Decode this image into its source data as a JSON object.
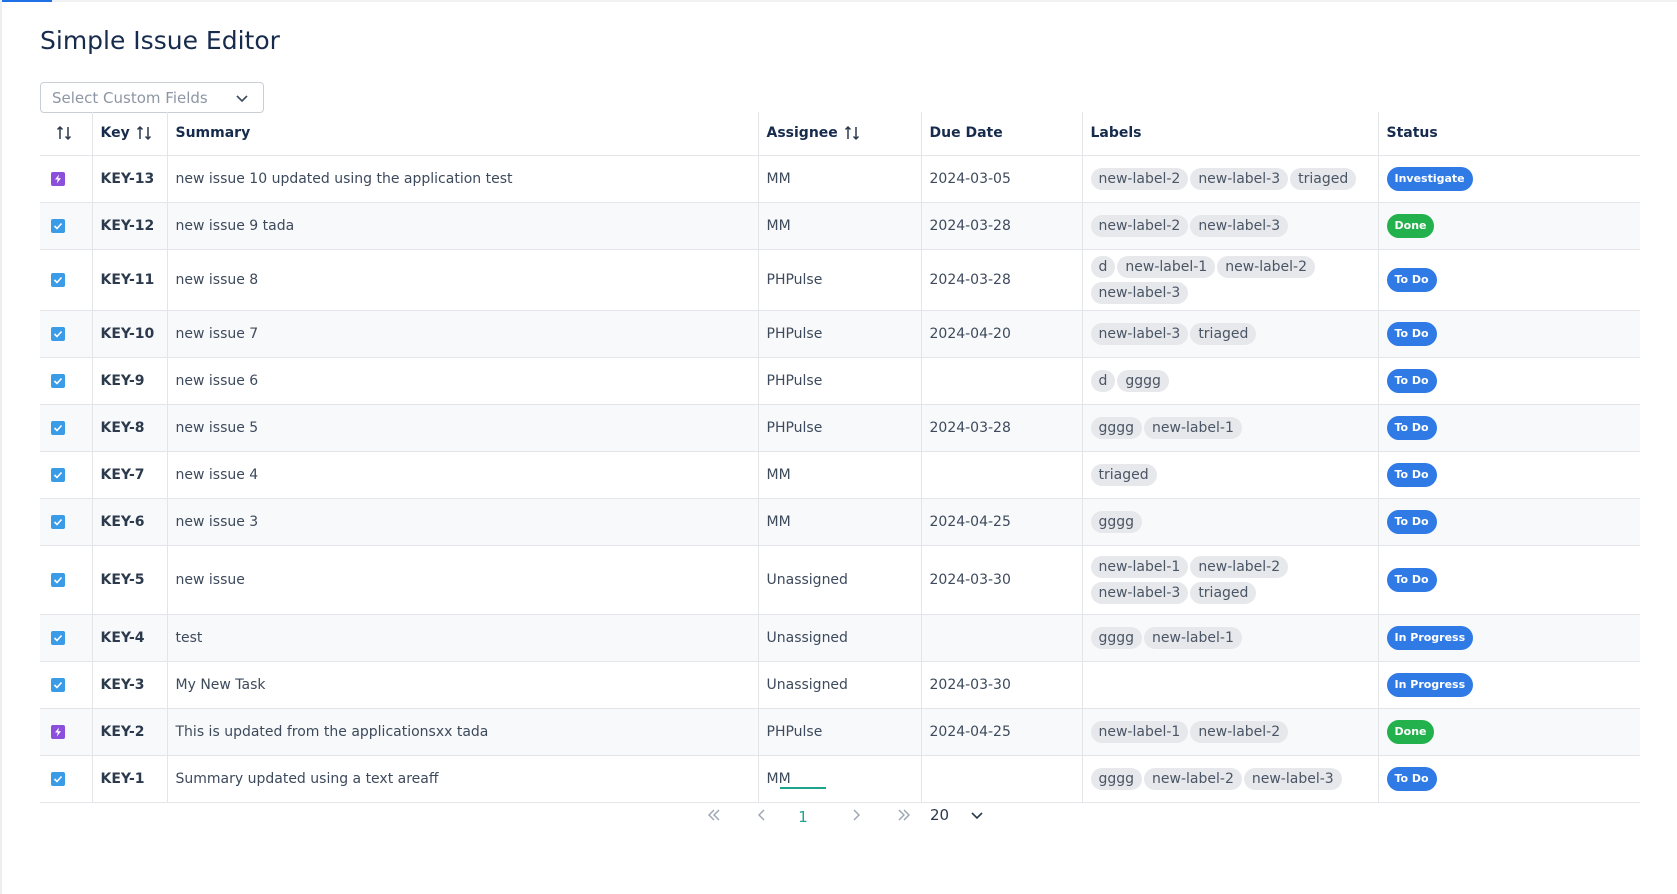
{
  "app": {
    "title": "Simple Issue Editor"
  },
  "custom_fields_select": {
    "placeholder": "Select Custom Fields"
  },
  "columns": {
    "key": "Key",
    "summary": "Summary",
    "assignee": "Assignee",
    "due_date": "Due Date",
    "labels": "Labels",
    "status": "Status"
  },
  "rows": [
    {
      "type": "epic",
      "key": "KEY-13",
      "summary": "new issue 10 updated using the application test",
      "assignee": "MM",
      "due": "2024-03-05",
      "labels": [
        "new-label-2",
        "new-label-3",
        "triaged"
      ],
      "status": "Investigate",
      "status_color": "#2f7ae5"
    },
    {
      "type": "task",
      "key": "KEY-12",
      "summary": "new issue 9 tada",
      "assignee": "MM",
      "due": "2024-03-28",
      "labels": [
        "new-label-2",
        "new-label-3"
      ],
      "status": "Done",
      "status_color": "#22b14c"
    },
    {
      "type": "task",
      "key": "KEY-11",
      "summary": "new issue 8",
      "assignee": "PHPulse",
      "due": "2024-03-28",
      "labels": [
        "d",
        "new-label-1",
        "new-label-2",
        "new-label-3"
      ],
      "status": "To Do",
      "status_color": "#2f7ae5"
    },
    {
      "type": "task",
      "key": "KEY-10",
      "summary": "new issue 7",
      "assignee": "PHPulse",
      "due": "2024-04-20",
      "labels": [
        "new-label-3",
        "triaged"
      ],
      "status": "To Do",
      "status_color": "#2f7ae5"
    },
    {
      "type": "task",
      "key": "KEY-9",
      "summary": "new issue 6",
      "assignee": "PHPulse",
      "due": "",
      "labels": [
        "d",
        "gggg"
      ],
      "status": "To Do",
      "status_color": "#2f7ae5"
    },
    {
      "type": "task",
      "key": "KEY-8",
      "summary": "new issue 5",
      "assignee": "PHPulse",
      "due": "2024-03-28",
      "labels": [
        "gggg",
        "new-label-1"
      ],
      "status": "To Do",
      "status_color": "#2f7ae5"
    },
    {
      "type": "task",
      "key": "KEY-7",
      "summary": "new issue 4",
      "assignee": "MM",
      "due": "",
      "labels": [
        "triaged"
      ],
      "status": "To Do",
      "status_color": "#2f7ae5"
    },
    {
      "type": "task",
      "key": "KEY-6",
      "summary": "new issue 3",
      "assignee": "MM",
      "due": "2024-04-25",
      "labels": [
        "gggg"
      ],
      "status": "To Do",
      "status_color": "#2f7ae5"
    },
    {
      "type": "task",
      "key": "KEY-5",
      "summary": "new issue",
      "assignee": "Unassigned",
      "due": "2024-03-30",
      "labels": [
        "new-label-1",
        "new-label-2",
        "new-label-3",
        "triaged"
      ],
      "status": "To Do",
      "status_color": "#2f7ae5"
    },
    {
      "type": "task",
      "key": "KEY-4",
      "summary": "test",
      "assignee": "Unassigned",
      "due": "",
      "labels": [
        "gggg",
        "new-label-1"
      ],
      "status": "In Progress",
      "status_color": "#2f7ae5"
    },
    {
      "type": "task",
      "key": "KEY-3",
      "summary": "My New Task",
      "assignee": "Unassigned",
      "due": "2024-03-30",
      "labels": [],
      "status": "In Progress",
      "status_color": "#2f7ae5"
    },
    {
      "type": "epic",
      "key": "KEY-2",
      "summary": "This is updated from the applicationsxx tada",
      "assignee": "PHPulse",
      "due": "2024-04-25",
      "labels": [
        "new-label-1",
        "new-label-2"
      ],
      "status": "Done",
      "status_color": "#22b14c"
    },
    {
      "type": "task",
      "key": "KEY-1",
      "summary": "Summary updated using a text areaff",
      "assignee": "MM",
      "due": "",
      "labels": [
        "gggg",
        "new-label-2",
        "new-label-3"
      ],
      "status": "To Do",
      "status_color": "#2f7ae5"
    }
  ],
  "pagination": {
    "current_page": "1",
    "page_size": "20"
  },
  "icons": {
    "sort": "sort-arrows-icon",
    "task": "checkbox-task-icon",
    "epic": "lightning-epic-icon",
    "first": "double-chevron-left-icon",
    "prev": "chevron-left-icon",
    "next": "chevron-right-icon",
    "last": "double-chevron-right-icon",
    "dropdown": "chevron-down-icon"
  }
}
